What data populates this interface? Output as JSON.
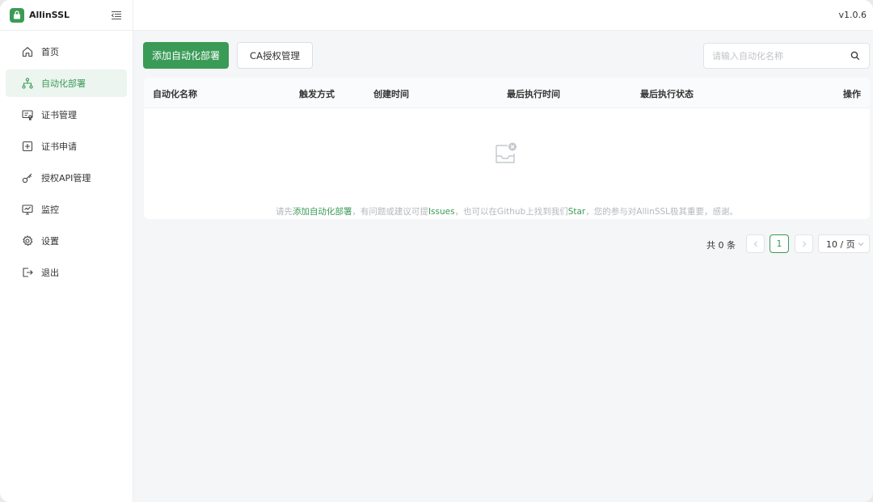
{
  "app": {
    "name": "AllinSSL",
    "version": "v1.0.6"
  },
  "sidebar": {
    "items": [
      {
        "label": "首页",
        "icon": "home-icon"
      },
      {
        "label": "自动化部署",
        "icon": "workflow-icon",
        "active": true
      },
      {
        "label": "证书管理",
        "icon": "certificate-icon"
      },
      {
        "label": "证书申请",
        "icon": "plus-square-icon"
      },
      {
        "label": "授权API管理",
        "icon": "key-icon"
      },
      {
        "label": "监控",
        "icon": "monitor-icon"
      },
      {
        "label": "设置",
        "icon": "gear-icon"
      },
      {
        "label": "退出",
        "icon": "logout-icon"
      }
    ]
  },
  "toolbar": {
    "add_label": "添加自动化部署",
    "ca_label": "CA授权管理",
    "search_placeholder": "请输入自动化名称"
  },
  "table": {
    "columns": [
      "自动化名称",
      "触发方式",
      "创建时间",
      "最后执行时间",
      "最后执行状态",
      "操作"
    ],
    "rows": []
  },
  "empty": {
    "prefix": "请先",
    "link1": "添加自动化部署",
    "middle1": "，有问题或建议可提",
    "link2": "Issues",
    "middle2": "，也可以在Github上找到我们",
    "link3": "Star",
    "suffix": "，您的参与对AllinSSL极其重要，感谢。"
  },
  "pagination": {
    "total_label": "共 0 条",
    "current_page": "1",
    "page_size_label": "10 / 页"
  },
  "colors": {
    "accent": "#3a9b57",
    "background": "#f5f6f8"
  }
}
